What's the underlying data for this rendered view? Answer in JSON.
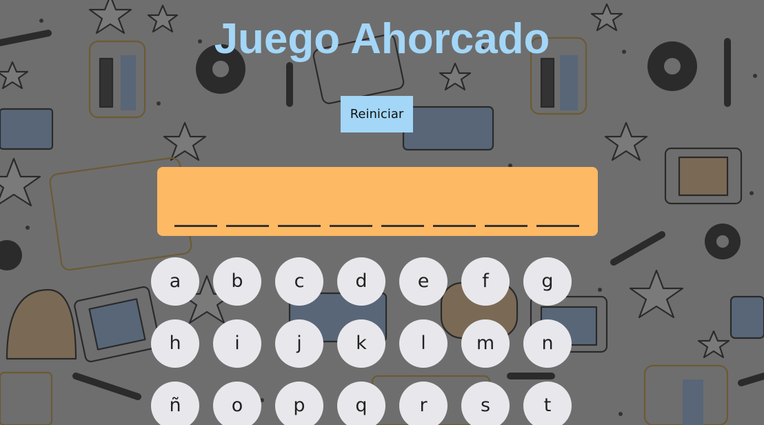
{
  "title": "Juego Ahorcado",
  "reset_label": "Reiniciar",
  "colors": {
    "title": "#a3d6f7",
    "reset_button": "#a3d6f7",
    "word_panel": "#fdb964",
    "key_background": "#e8e8ec",
    "page_background": "#6e6e6e"
  },
  "word": {
    "revealed": [
      "",
      "",
      "",
      "",
      "",
      "",
      "",
      ""
    ]
  },
  "keyboard": {
    "rows": [
      [
        "a",
        "b",
        "c",
        "d",
        "e",
        "f",
        "g"
      ],
      [
        "h",
        "i",
        "j",
        "k",
        "l",
        "m",
        "n"
      ],
      [
        "ñ",
        "o",
        "p",
        "q",
        "r",
        "s",
        "t"
      ]
    ]
  },
  "background_icons": [
    "robot-doodle",
    "tv-doodle",
    "gear-doodle",
    "wrench-doodle",
    "star-doodle",
    "radio-doodle"
  ]
}
